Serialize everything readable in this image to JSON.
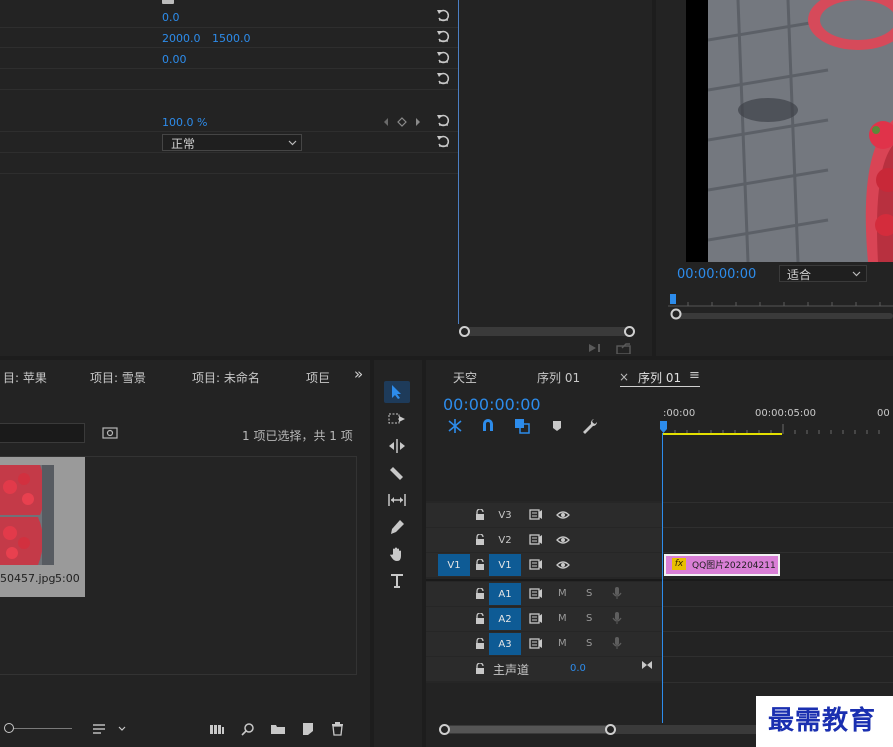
{
  "effect_controls": {
    "rows": [
      {
        "value": "0.0"
      },
      {
        "value": "2000.0",
        "value2": "1500.0"
      },
      {
        "value": "0.00"
      },
      {
        "value": ""
      },
      {
        "value": "100.0 %"
      }
    ],
    "blend_mode": "正常"
  },
  "program_monitor": {
    "timecode": "00:00:00:00",
    "fit_option": "适合"
  },
  "project_panel": {
    "tabs": [
      "目: 苹果",
      "项目: 雪景",
      "项目: 未命名",
      "项巨"
    ],
    "overflow": "»",
    "selection_info": "1 项已选择，共 1 项",
    "clip_name": "50457.jpg",
    "clip_duration": "5:00"
  },
  "timeline": {
    "tabs": [
      "天空",
      "序列 01",
      "序列 01"
    ],
    "close_glyph": "×",
    "menu_glyph": "≡",
    "timecode": "00:00:00:00",
    "ruler": [
      ":00:00",
      "00:00:05:00",
      "00"
    ],
    "video_tracks": [
      {
        "label": "V3",
        "source": ""
      },
      {
        "label": "V2",
        "source": ""
      },
      {
        "label": "V1",
        "source": "V1"
      }
    ],
    "audio_tracks": [
      {
        "label": "A1",
        "m": "M",
        "s": "S"
      },
      {
        "label": "A2",
        "m": "M",
        "s": "S"
      },
      {
        "label": "A3",
        "m": "M",
        "s": "S"
      }
    ],
    "master_label": "主声道",
    "master_value": "0.0",
    "clip": {
      "fx": "fx",
      "name": "QQ图片202204211"
    }
  },
  "watermark": "最需教育",
  "colors": {
    "accent": "#2d8ceb",
    "clip": "#d97fd6",
    "track_on": "#0e5b95"
  }
}
